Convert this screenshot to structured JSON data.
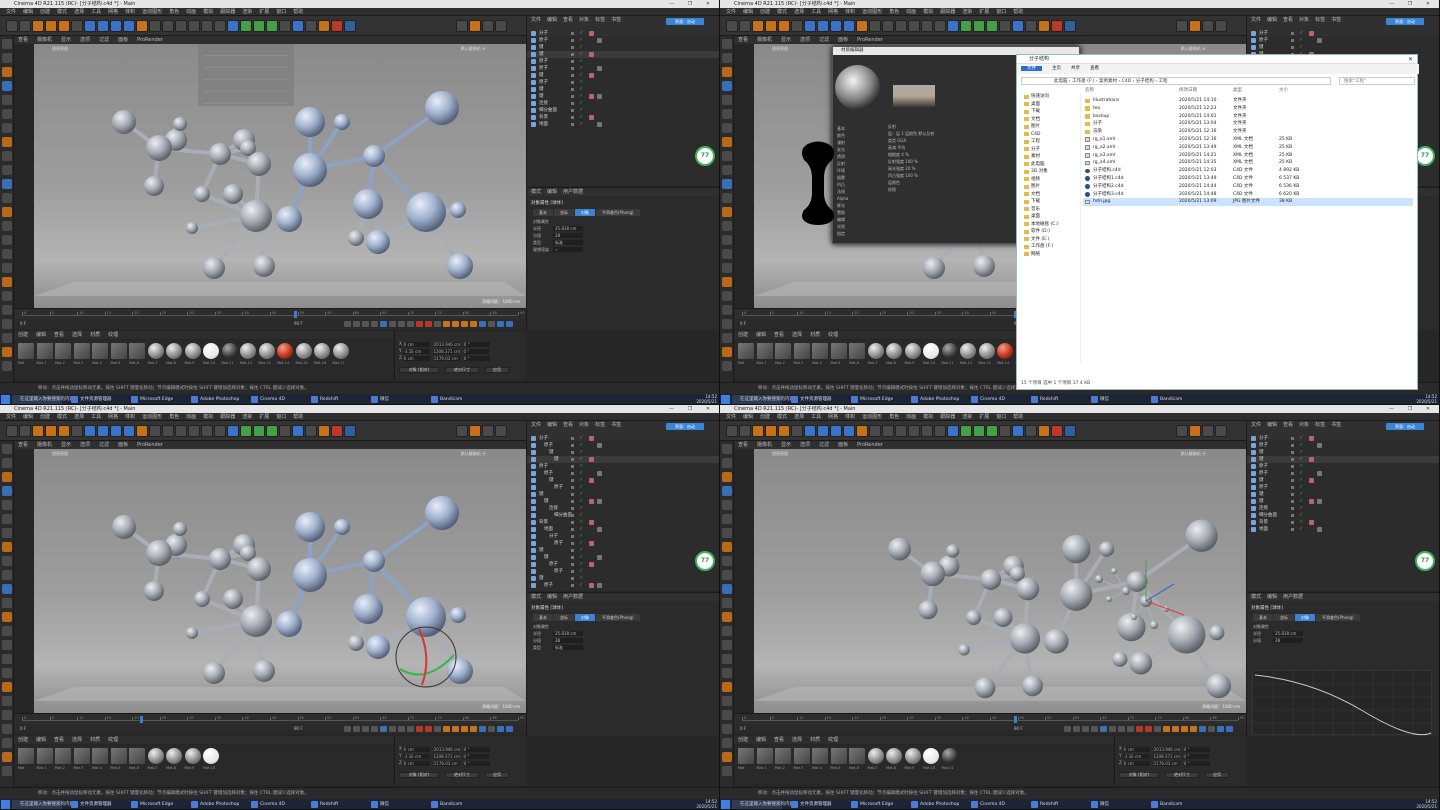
{
  "window": {
    "title": "Cinema 4D R21.115 (RC)- [分子结构.c4d *] - Main",
    "controls": "— ❐ ✕"
  },
  "menu": [
    "文件",
    "编辑",
    "创建",
    "模式",
    "选择",
    "工具",
    "网格",
    "体积",
    "运动图形",
    "角色",
    "动画",
    "模拟",
    "跟踪器",
    "渲染",
    "扩展",
    "窗口",
    "帮助"
  ],
  "viewport_menu": [
    "查看",
    "摄像机",
    "显示",
    "选项",
    "过滤",
    "面板",
    "ProRender"
  ],
  "viewport_label": "透视视图",
  "viewport_camera_label": "默认摄像机 ⦿",
  "grid_spacing": "网格间距：1000 cm",
  "object_manager": {
    "tabs": [
      "文件",
      "编辑",
      "查看",
      "对象",
      "标签",
      "书签"
    ],
    "interface_badge": "界面：启动",
    "rows": [
      "分子",
      "原子",
      "键",
      "键",
      "原子",
      "原子",
      "键",
      "原子",
      "键",
      "键",
      "连接",
      "细分曲面",
      "背景",
      "地面"
    ]
  },
  "attribute_manager": {
    "tabs_header": [
      "模式",
      "编辑",
      "用户数据"
    ],
    "title": "对象属性 [球体]",
    "tabs": [
      "基本",
      "坐标",
      "对象",
      "平滑着色(Phong)"
    ],
    "section": "对象属性",
    "props": [
      {
        "label": "半径",
        "value": "25.818 cm"
      },
      {
        "label": "分段",
        "value": "28"
      },
      {
        "label": "类型",
        "value": "标准"
      },
      {
        "label": "理想渲染",
        "value": "✓"
      }
    ]
  },
  "timeline": {
    "start": "0 F",
    "end": "90 F",
    "current": "0 F",
    "ticks": [
      "0",
      "5",
      "10",
      "15",
      "20",
      "25",
      "30",
      "35",
      "40",
      "45",
      "50",
      "55",
      "60",
      "65",
      "70",
      "75",
      "80",
      "85",
      "90"
    ]
  },
  "material_menu": [
    "创建",
    "编辑",
    "查看",
    "选择",
    "材质",
    "纹理"
  ],
  "materials": [
    "Mat",
    "Mat.1",
    "Mat.2",
    "Mat.3",
    "Mat.4",
    "Mat.5",
    "Mat.6",
    "Mat.7",
    "Mat.8",
    "Mat.9",
    "Mat.10",
    "Mat.11",
    "Mat.12",
    "Mat.13",
    "Mat.14",
    "Mat.15",
    "Mat.16",
    "Mat.17"
  ],
  "coordinates": {
    "rows": [
      {
        "axis": "X",
        "pos": "0 cm",
        "size": "2013.946 cm",
        "rot": "0 °"
      },
      {
        "axis": "Y",
        "pos": "-3.1E cm",
        "size": "1208.371 cm",
        "rot": "0 °"
      },
      {
        "axis": "Z",
        "pos": "0 cm",
        "size": "1176.03 cm",
        "rot": "0 °"
      }
    ],
    "mode": "对象 (相对)",
    "size_mode": "绝对尺寸",
    "apply": "应用"
  },
  "status_text": "移动：点击并拖动鼠标移动元素。按住 SHIFT 键量化移动；节点编辑模式时按住 SHIFT 键增加选择对象；按住 CTRL 键减少选择对象。",
  "taskbar": {
    "search": "在这里输入你要搜索的内容",
    "apps": [
      "文件资源管理器",
      "Microsoft Edge",
      "Adobe Photoshop",
      "Cinema 4D",
      "Redshift",
      "微信",
      "Bandicam"
    ],
    "time": "14:52",
    "date": "2020/5/21"
  },
  "logo_text": "77",
  "material_dialog": {
    "title": "材质编辑器",
    "channels": [
      "基本",
      "颜色",
      "漫射",
      "发光",
      "透明",
      "反射",
      "环境",
      "烟雾",
      "凹凸",
      "法线",
      "Alpha",
      "辉光",
      "置换",
      "编辑",
      "光照",
      "指定"
    ],
    "props": [
      "反射",
      "层：层 1  层颜色  默认反射",
      "类型    GGX",
      "衰减    平均",
      "粗糙度  4 %",
      "反射强度 100 %",
      "高光强度 20 %",
      "凹凸强度 100 %",
      "层颜色",
      "纹理"
    ]
  },
  "explorer": {
    "title": "分子结构",
    "ribbon": [
      "文件",
      "主页",
      "共享",
      "查看"
    ],
    "address": "此电脑 › 工作盘 (F:) › 案例素材 › C4D › 分子结构 › 工程",
    "search_placeholder": "搜索\"工程\"",
    "nav": [
      "快速访问",
      "桌面",
      "下载",
      "文档",
      "图片",
      "C4D",
      "工程",
      "分子",
      "素材",
      "此电脑",
      "3D 对象",
      "视频",
      "图片",
      "文档",
      "下载",
      "音乐",
      "桌面",
      "本地磁盘 (C:)",
      "软件 (D:)",
      "文件 (E:)",
      "工作盘 (F:)",
      "网络"
    ],
    "columns": [
      "名称",
      "修改日期",
      "类型",
      "大小"
    ],
    "files": [
      {
        "name": "Illustrations",
        "date": "2020/5/21 14:10",
        "type": "文件夹",
        "size": "",
        "kind": "folder"
      },
      {
        "name": "tex",
        "date": "2020/5/21 12:23",
        "type": "文件夹",
        "size": "",
        "kind": "folder"
      },
      {
        "name": "backup",
        "date": "2020/5/21 14:01",
        "type": "文件夹",
        "size": "",
        "kind": "folder"
      },
      {
        "name": "分子",
        "date": "2020/5/21 13:04",
        "type": "文件夹",
        "size": "",
        "kind": "folder"
      },
      {
        "name": "渲染",
        "date": "2020/5/21 12:16",
        "type": "文件夹",
        "size": "",
        "kind": "folder"
      },
      {
        "name": "rg_a1.xml",
        "date": "2020/5/21 12:16",
        "type": "XML 文档",
        "size": "25 KB",
        "kind": "doc"
      },
      {
        "name": "rg_a2.xml",
        "date": "2020/5/21 13:49",
        "type": "XML 文档",
        "size": "25 KB",
        "kind": "doc"
      },
      {
        "name": "rg_a3.xml",
        "date": "2020/5/21 14:21",
        "type": "XML 文档",
        "size": "25 KB",
        "kind": "doc"
      },
      {
        "name": "rg_a4.xml",
        "date": "2020/5/21 14:35",
        "type": "XML 文档",
        "size": "25 KB",
        "kind": "doc"
      },
      {
        "name": "分子结构.c4d",
        "date": "2020/5/21 12:03",
        "type": "C4D 文件",
        "size": "4 892 KB",
        "kind": "c4d"
      },
      {
        "name": "分子结构1.c4d",
        "date": "2020/5/21 13:49",
        "type": "C4D 文件",
        "size": "6 537 KB",
        "kind": "c4d"
      },
      {
        "name": "分子结构2.c4d",
        "date": "2020/5/21 14:44",
        "type": "C4D 文件",
        "size": "6 536 KB",
        "kind": "c4d"
      },
      {
        "name": "分子结构3.c4d",
        "date": "2020/5/21 14:48",
        "type": "C4D 文件",
        "size": "6 620 KB",
        "kind": "c4d"
      },
      {
        "name": "hdri.jpg",
        "date": "2020/5/21 13:09",
        "type": "JPG 图片文件",
        "size": "38 KB",
        "kind": "doc"
      }
    ],
    "status": "15 个项目   选中 1 个项目  37.4 KB"
  },
  "colors": {
    "accent": "#3a86d6",
    "orange": "#c8711a",
    "selection": "#cce4fb"
  }
}
